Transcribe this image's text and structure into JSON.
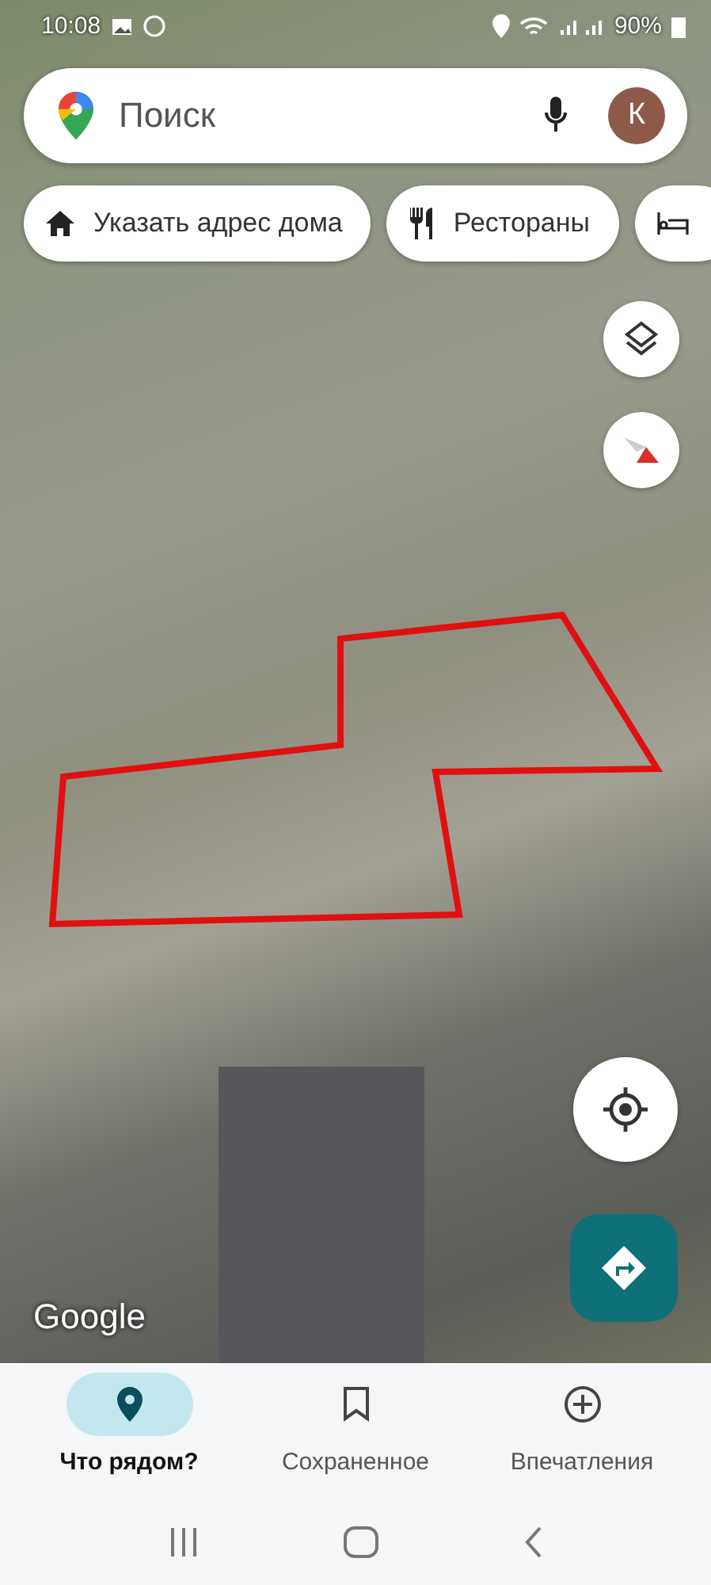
{
  "status_bar": {
    "time": "10:08",
    "battery": "90%"
  },
  "search": {
    "placeholder": "Поиск",
    "avatar": "К"
  },
  "chips": [
    {
      "kind": "home",
      "label": "Указать адрес дома"
    },
    {
      "kind": "dining",
      "label": "Рестораны"
    },
    {
      "kind": "lodging"
    }
  ],
  "map": {
    "attribution": "Google"
  },
  "bottom_nav": [
    {
      "kind": "explore",
      "label": "Что рядом?",
      "selected": true
    },
    {
      "kind": "saved",
      "label": "Сохраненное",
      "selected": false
    },
    {
      "kind": "contribute",
      "label": "Впечатления",
      "selected": false
    }
  ]
}
